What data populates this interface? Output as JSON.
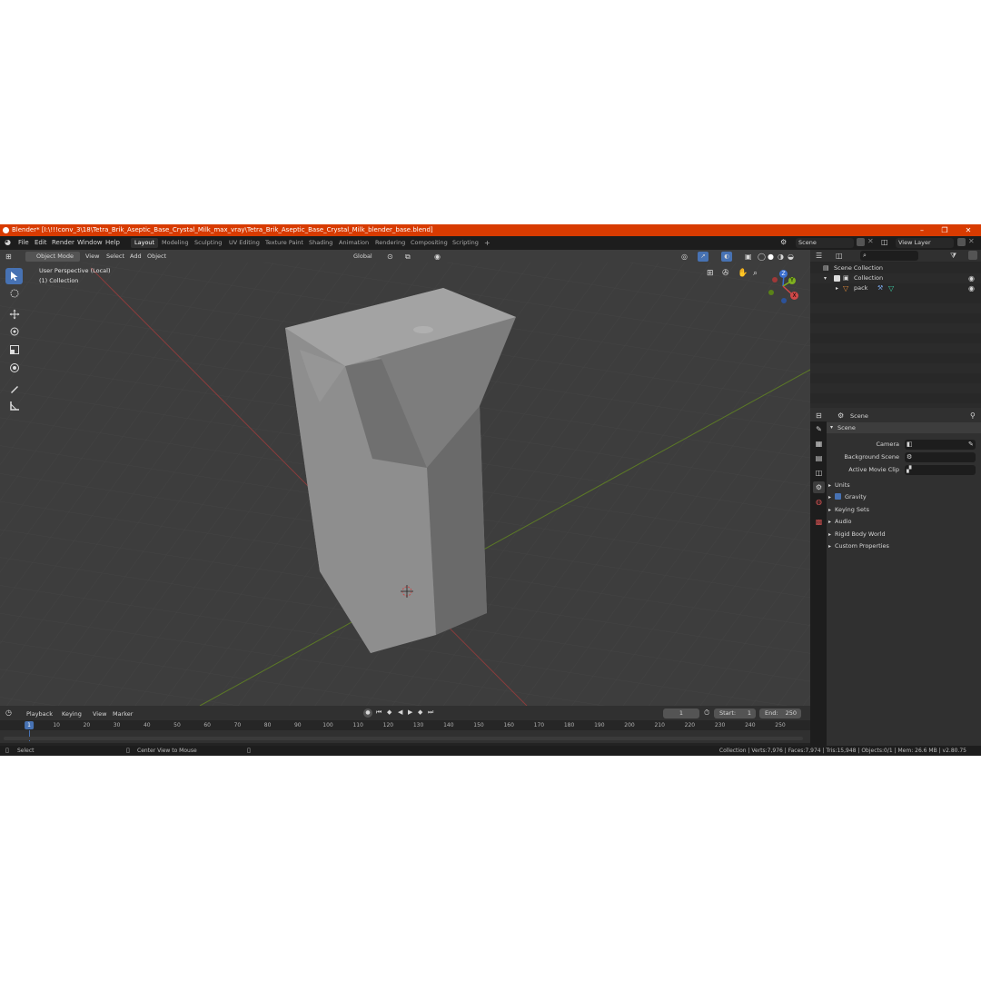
{
  "window": {
    "title": "Blender* [I:\\!!!conv_3\\18\\Tetra_Brik_Aseptic_Base_Crystal_Milk_max_vray\\Tetra_Brik_Aseptic_Base_Crystal_Milk_blender_base.blend]",
    "minimize": "–",
    "maximize": "❐",
    "close": "✕"
  },
  "menu": [
    "File",
    "Edit",
    "Render",
    "Window",
    "Help"
  ],
  "workspaces": [
    "Layout",
    "Modeling",
    "Sculpting",
    "UV Editing",
    "Texture Paint",
    "Shading",
    "Animation",
    "Rendering",
    "Compositing",
    "Scripting"
  ],
  "workspace_add": "+",
  "scene": {
    "name": "Scene",
    "view_layer": "View Layer"
  },
  "viewport": {
    "mode": "Object Mode",
    "menus": [
      "View",
      "Select",
      "Add",
      "Object"
    ],
    "orientation": "Global",
    "overlay_line1": "User Perspective (Local)",
    "overlay_line2": "(1) Collection",
    "gizmo": {
      "z": "Z",
      "y": "Y",
      "x": "X"
    }
  },
  "outliner": {
    "search_placeholder": "",
    "root": "Scene Collection",
    "collection": "Collection",
    "object": "pack"
  },
  "properties": {
    "header": "Scene",
    "panel": "Scene",
    "fields": {
      "camera": "Camera",
      "background_scene": "Background Scene",
      "active_movie_clip": "Active Movie Clip"
    },
    "subpanels": [
      "Units",
      "Gravity",
      "Keying Sets",
      "Audio",
      "Rigid Body World",
      "Custom Properties"
    ]
  },
  "timeline": {
    "menus": [
      "Playback",
      "Keying",
      "View",
      "Marker"
    ],
    "current_frame": "1",
    "start_label": "Start:",
    "start": "1",
    "end_label": "End:",
    "end": "250",
    "ruler": [
      "1",
      "10",
      "20",
      "30",
      "40",
      "50",
      "60",
      "70",
      "80",
      "90",
      "100",
      "110",
      "120",
      "130",
      "140",
      "150",
      "160",
      "170",
      "180",
      "190",
      "200",
      "210",
      "220",
      "230",
      "240",
      "250"
    ]
  },
  "statusbar": {
    "select": "Select",
    "center": "Center View to Mouse",
    "stats": "Collection | Verts:7,976 | Faces:7,974 | Tris:15,948 | Objects:0/1 | Mem: 26.6 MB | v2.80.75"
  },
  "colors": {
    "accent": "#4772b3",
    "titlebar": "#d83b01",
    "x_axis": "#b33a3a",
    "y_axis": "#6b8f23"
  }
}
